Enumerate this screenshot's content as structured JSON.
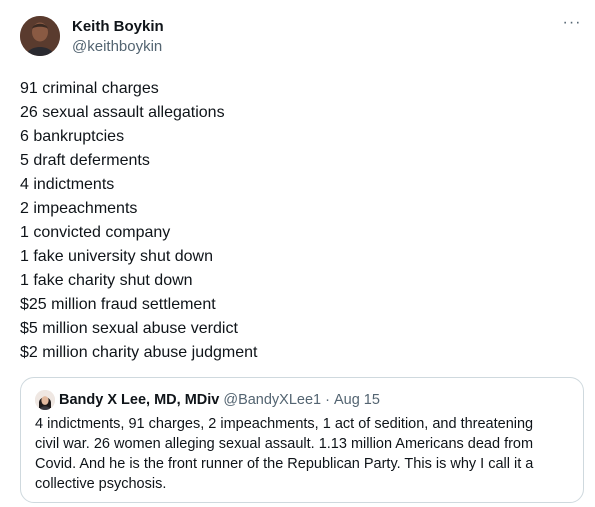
{
  "author": {
    "display_name": "Keith Boykin",
    "handle": "@keithboykin"
  },
  "more_icon": "···",
  "tweet_lines": [
    "91 criminal charges",
    "26 sexual assault allegations",
    "6 bankruptcies",
    "5 draft deferments",
    "4 indictments",
    "2 impeachments",
    "1 convicted company",
    "1 fake university shut down",
    "1 fake charity shut down",
    "$25 million fraud settlement",
    "$5 million sexual abuse verdict",
    "$2 million charity abuse judgment"
  ],
  "quote": {
    "display_name": "Bandy X Lee, MD, MDiv",
    "handle": "@BandyXLee1",
    "separator": "·",
    "date": "Aug 15",
    "text": "4 indictments, 91 charges, 2 impeachments, 1 act of sedition, and threatening\ncivil war.  26 women alleging sexual assault.  1.13 million Americans dead from\nCovid.  And he is the front runner of the Republican Party.  This is why I call it a\ncollective psychosis."
  },
  "colors": {
    "text_primary": "#0f1419",
    "text_secondary": "#536471",
    "border": "#cfd9de"
  }
}
